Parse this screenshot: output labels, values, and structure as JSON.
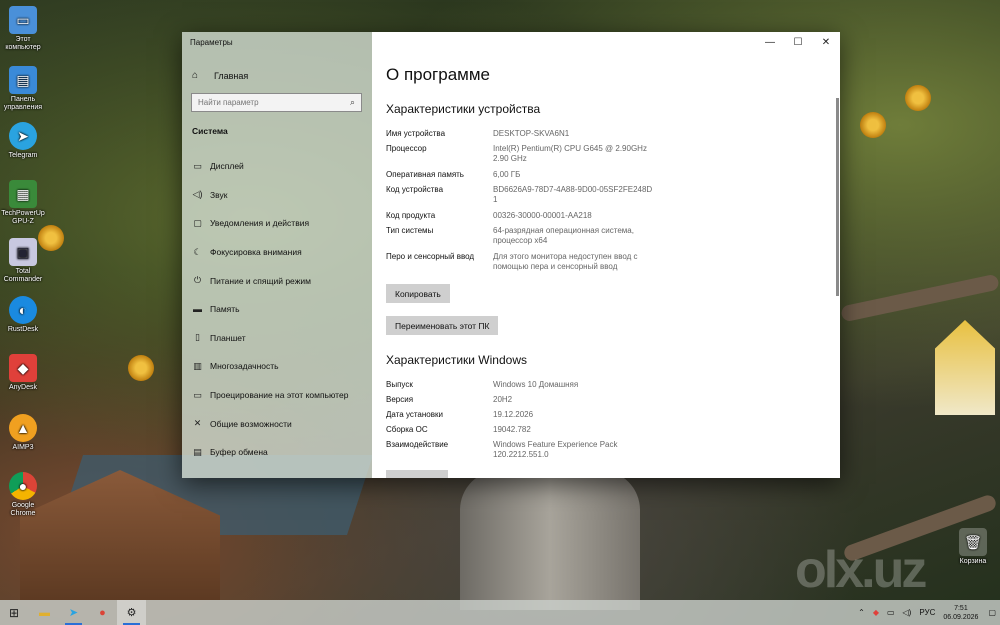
{
  "desktop": {
    "icons": [
      {
        "label": "Этот компьютер",
        "icon": "computer-icon",
        "color": "#4a90d9"
      },
      {
        "label": "Панель управления",
        "icon": "control-panel-icon",
        "color": "#3a8ad8"
      },
      {
        "label": "Telegram",
        "icon": "telegram-icon",
        "color": "#2aa3e0"
      },
      {
        "label": "TechPowerUp GPU-Z",
        "icon": "gpuz-icon",
        "color": "#3a8a3a"
      },
      {
        "label": "Total Commander",
        "icon": "total-commander-icon",
        "color": "#d0d0e0"
      },
      {
        "label": "RustDesk",
        "icon": "rustdesk-icon",
        "color": "#1a8ae0"
      },
      {
        "label": "AnyDesk",
        "icon": "anydesk-icon",
        "color": "#e0403a"
      },
      {
        "label": "AIMP3",
        "icon": "aimp-icon",
        "color": "#f0a020"
      },
      {
        "label": "Google Chrome",
        "icon": "chrome-icon",
        "color": "#db4437"
      }
    ],
    "recycle_bin": "Корзина",
    "watermark": "olx.uz"
  },
  "window": {
    "title": "Параметры",
    "home": "Главная",
    "search_placeholder": "Найти параметр",
    "section": "Система",
    "nav": [
      {
        "label": "Дисплей",
        "icon": "display-icon"
      },
      {
        "label": "Звук",
        "icon": "sound-icon"
      },
      {
        "label": "Уведомления и действия",
        "icon": "notifications-icon"
      },
      {
        "label": "Фокусировка внимания",
        "icon": "focus-icon"
      },
      {
        "label": "Питание и спящий режим",
        "icon": "power-icon"
      },
      {
        "label": "Память",
        "icon": "storage-icon"
      },
      {
        "label": "Планшет",
        "icon": "tablet-icon"
      },
      {
        "label": "Многозадачность",
        "icon": "multitasking-icon"
      },
      {
        "label": "Проецирование на этот компьютер",
        "icon": "projecting-icon"
      },
      {
        "label": "Общие возможности",
        "icon": "shared-experiences-icon"
      },
      {
        "label": "Буфер обмена",
        "icon": "clipboard-icon"
      }
    ],
    "page_title": "О программе",
    "device_heading": "Характеристики устройства",
    "device_specs": [
      {
        "key": "Имя устройства",
        "value": "DESKTOP-SKVA6N1"
      },
      {
        "key": "Процессор",
        "value": "Intel(R) Pentium(R) CPU G645 @ 2.90GHz 2.90 GHz"
      },
      {
        "key": "Оперативная память",
        "value": "6,00 ГБ"
      },
      {
        "key": "Код устройства",
        "value": "BD6626A9-78D7-4A88-9D00-05SF2FE248D1"
      },
      {
        "key": "Код продукта",
        "value": "00326-30000-00001-AA218"
      },
      {
        "key": "Тип системы",
        "value": "64-разрядная операционная система, процессор x64"
      },
      {
        "key": "Перо и сенсорный ввод",
        "value": "Для этого монитора недоступен ввод с помощью пера и сенсорный ввод"
      }
    ],
    "copy_button": "Копировать",
    "rename_button": "Переименовать этот ПК",
    "windows_heading": "Характеристики Windows",
    "windows_specs": [
      {
        "key": "Выпуск",
        "value": "Windows 10 Домашняя"
      },
      {
        "key": "Версия",
        "value": "20H2"
      },
      {
        "key": "Дата установки",
        "value": "19.12.2026"
      },
      {
        "key": "Сборка ОС",
        "value": "19042.782"
      },
      {
        "key": "Взаимодействие",
        "value": "Windows Feature Experience Pack 120.2212.551.0"
      }
    ]
  },
  "taskbar": {
    "apps": [
      "explorer-icon",
      "telegram-icon",
      "chrome-icon",
      "settings-icon"
    ],
    "language": "РУС",
    "time": "7:51",
    "date": "06.09.2026"
  }
}
